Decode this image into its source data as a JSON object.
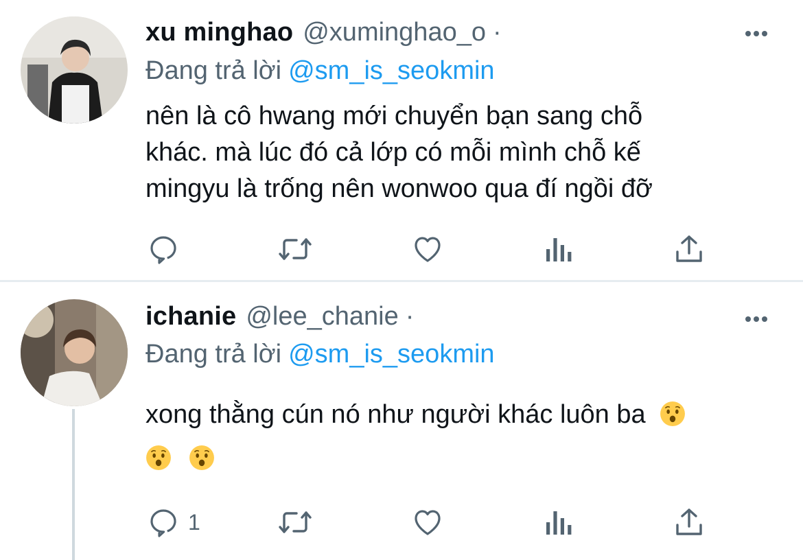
{
  "tweets": [
    {
      "name": "xu minghao",
      "handle": "@xuminghao_o",
      "separator": "·",
      "replying_prefix": "Đang trả lời",
      "replying_to": "@sm_is_seokmin",
      "lines": [
        "nên là cô hwang mới chuyển bạn sang chỗ",
        "khác. mà lúc đó cả lớp có mỗi mình chỗ kế",
        "mingyu là trống nên wonwoo qua đí ngồi đỡ"
      ],
      "reply_count": ""
    },
    {
      "name": "ichanie",
      "handle": "@lee_chanie",
      "separator": "·",
      "replying_prefix": "Đang trả lời",
      "replying_to": "@sm_is_seokmin",
      "text": "xong thằng cún nó như người khác luôn ba",
      "emoji_name": "hushed-face-emoji",
      "reply_count": "1"
    }
  ],
  "colors": {
    "accent": "#1d9bf0",
    "secondary_text": "#536471",
    "divider": "#e6ecf0"
  }
}
